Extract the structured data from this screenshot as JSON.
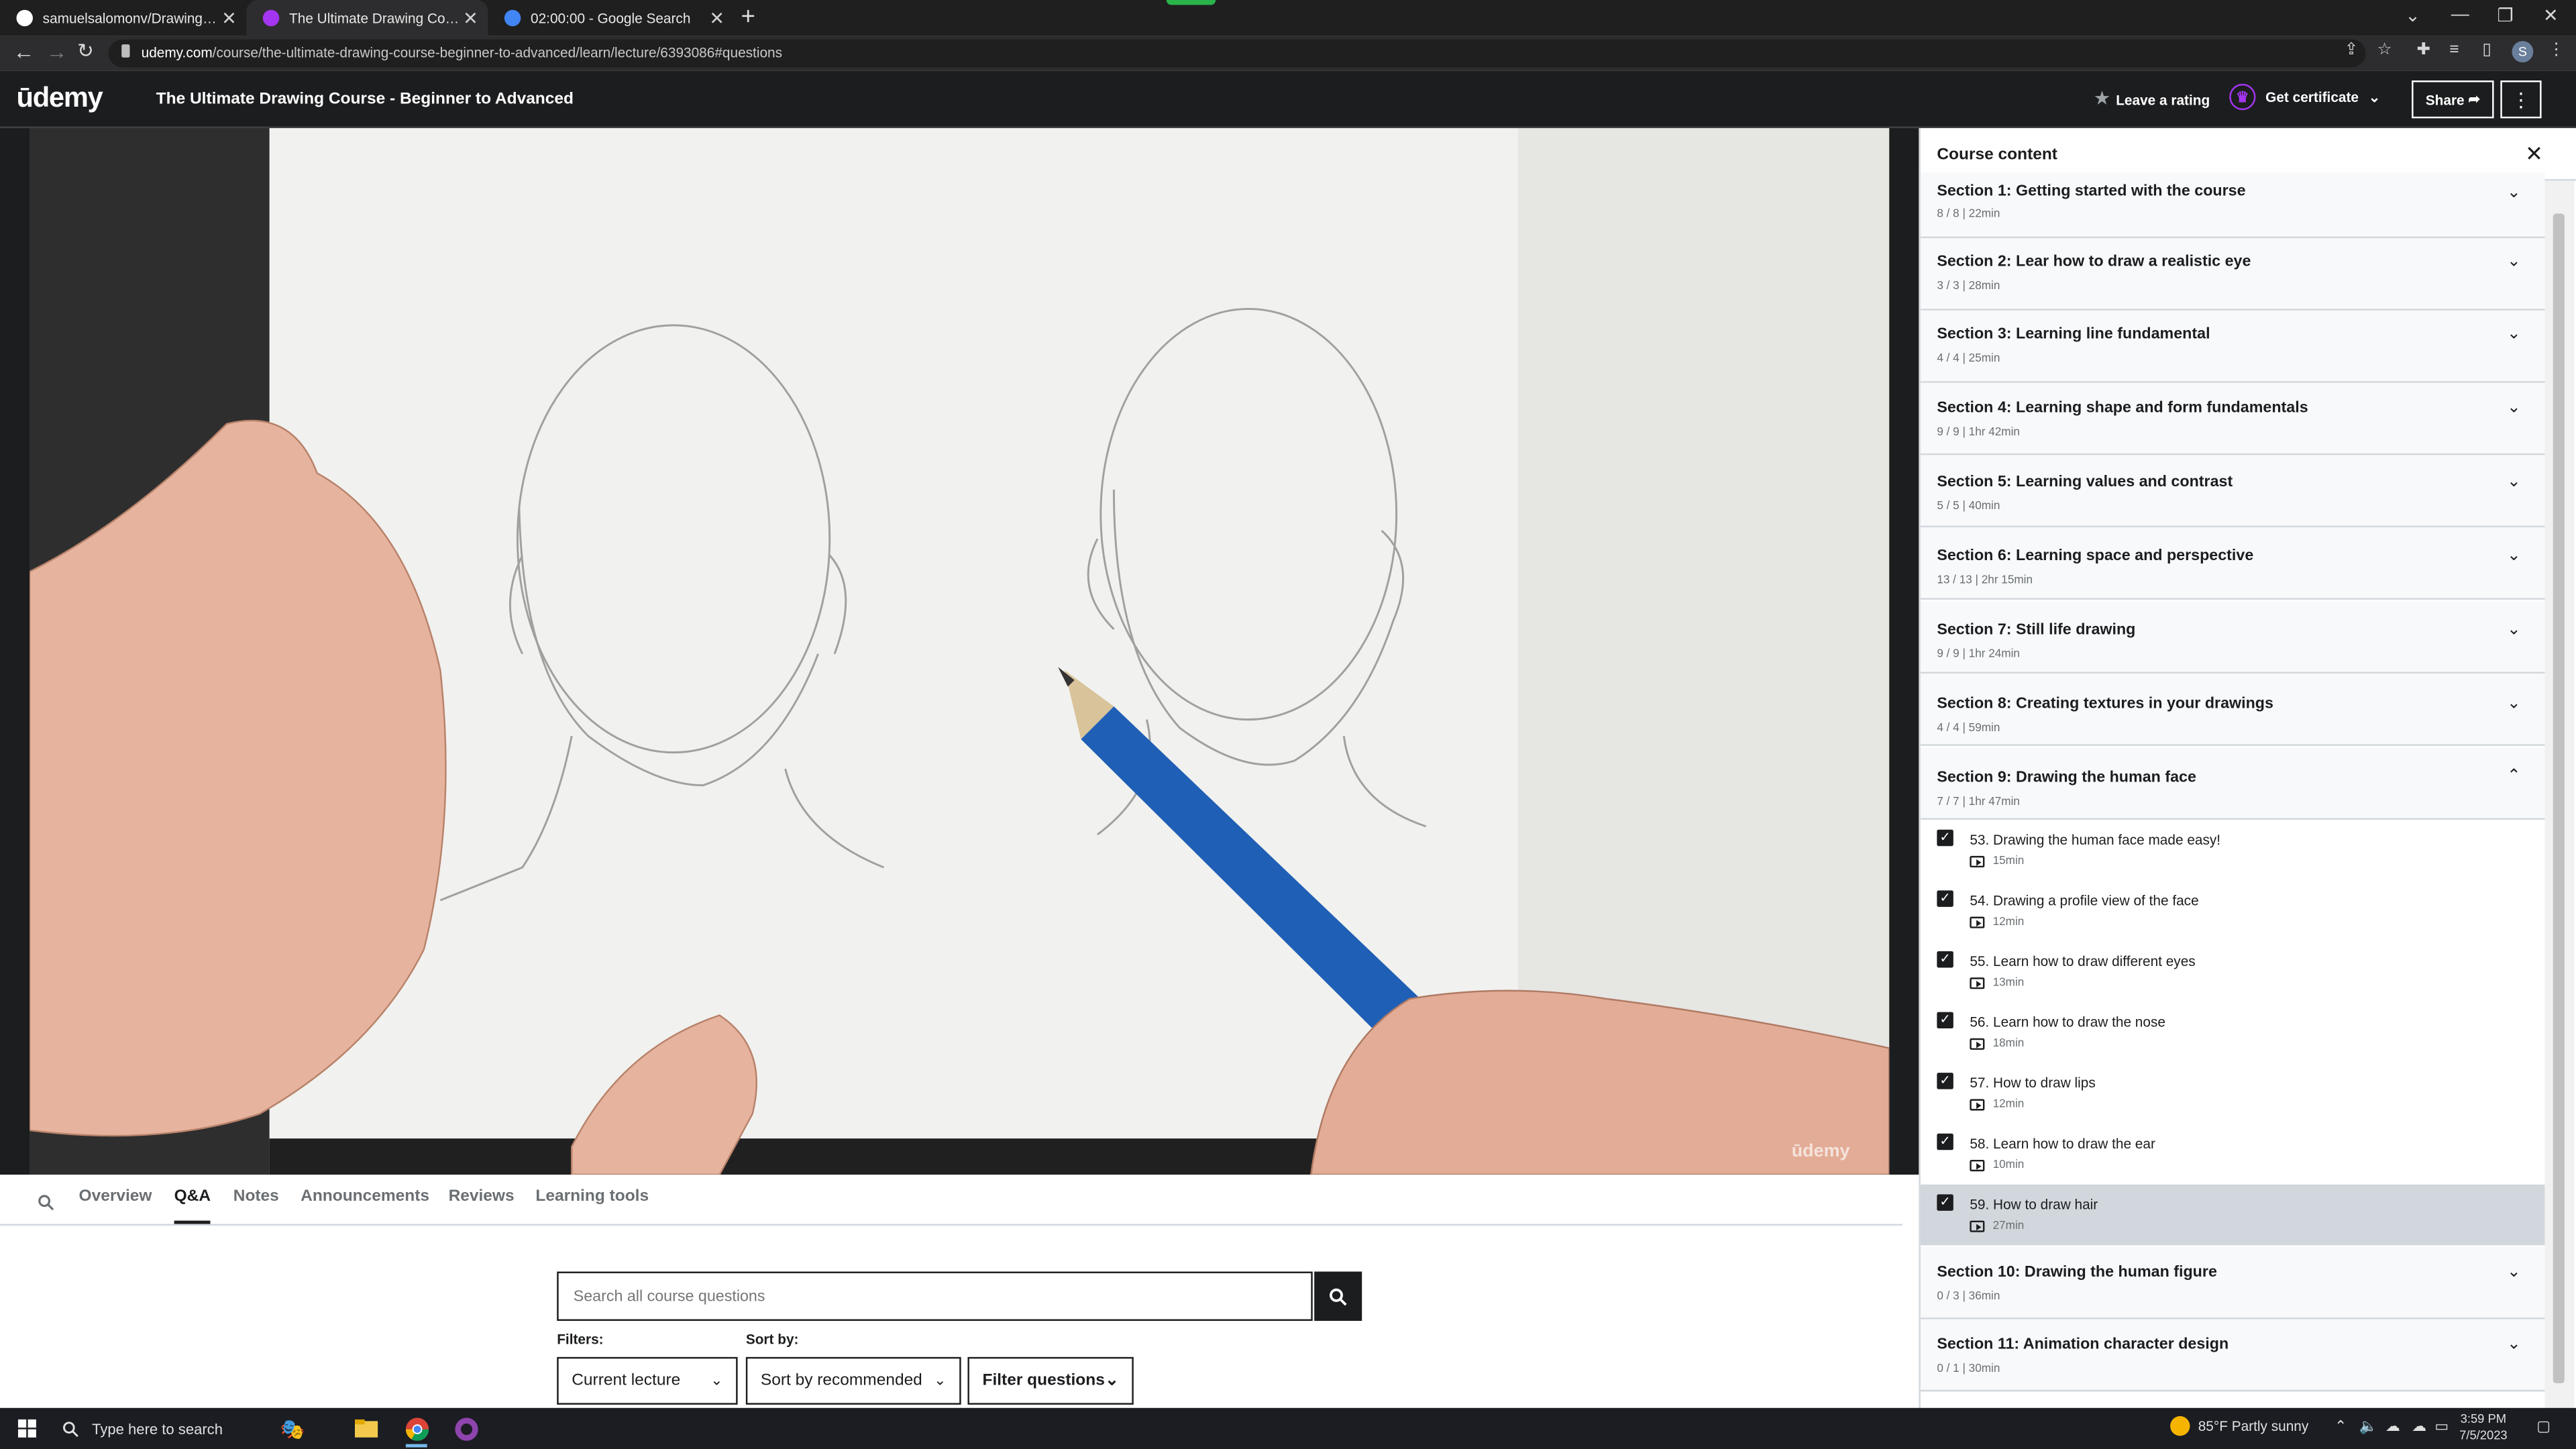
{
  "browser": {
    "tabs": [
      {
        "title": "samuelsalomonv/DrawingCourse",
        "active": false,
        "favicon": "github-icon"
      },
      {
        "title": "The Ultimate Drawing Course - B",
        "active": true,
        "favicon": "udemy-icon"
      },
      {
        "title": "02:00:00 - Google Search",
        "active": false,
        "favicon": "google-icon"
      }
    ],
    "url_host": "udemy.com",
    "url_path": "/course/the-ultimate-drawing-course-beginner-to-advanced/learn/lecture/6393086#questions"
  },
  "header": {
    "logo": "ūdemy",
    "course_title": "The Ultimate Drawing Course - Beginner to Advanced",
    "rate_label": "Leave a rating",
    "certificate_label": "Get certificate",
    "share_label": "Share",
    "accent": "#a435f0"
  },
  "video": {
    "watermark": "ūdemy"
  },
  "lower_tabs": {
    "items": [
      "Overview",
      "Q&A",
      "Notes",
      "Announcements",
      "Reviews",
      "Learning tools"
    ],
    "active": "Q&A"
  },
  "qa": {
    "search_placeholder": "Search all course questions",
    "filters_label": "Filters:",
    "sort_label": "Sort by:",
    "filter_value": "Current lecture",
    "sort_value": "Sort by recommended",
    "filter_questions_label": "Filter questions"
  },
  "sidebar": {
    "title": "Course content",
    "sections_before": [
      {
        "title": "Section 1: Getting started with the course",
        "meta": "8 / 8 | 22min"
      },
      {
        "title": "Section 2: Lear how to draw a realistic eye",
        "meta": "3 / 3 | 28min"
      },
      {
        "title": "Section 3: Learning line fundamental",
        "meta": "4 / 4 | 25min"
      },
      {
        "title": "Section 4: Learning shape and form fundamentals",
        "meta": "9 / 9 | 1hr 42min"
      },
      {
        "title": "Section 5: Learning values and contrast",
        "meta": "5 / 5 | 40min"
      },
      {
        "title": "Section 6: Learning space and perspective",
        "meta": "13 / 13 | 2hr 15min"
      },
      {
        "title": "Section 7: Still life drawing",
        "meta": "9 / 9 | 1hr 24min"
      },
      {
        "title": "Section 8: Creating textures in your drawings",
        "meta": "4 / 4 | 59min"
      },
      {
        "title": "Section 9: Drawing the human face",
        "meta": "7 / 7 | 1hr 47min"
      }
    ],
    "lectures": [
      {
        "title": "53. Drawing the human face made easy!",
        "duration": "15min",
        "current": false
      },
      {
        "title": "54. Drawing a profile view of the face",
        "duration": "12min",
        "current": false
      },
      {
        "title": "55. Learn how to draw different eyes",
        "duration": "13min",
        "current": false
      },
      {
        "title": "56. Learn how to draw the nose",
        "duration": "18min",
        "current": false
      },
      {
        "title": "57. How to draw lips",
        "duration": "12min",
        "current": false
      },
      {
        "title": "58. Learn how to draw the ear",
        "duration": "10min",
        "current": false
      },
      {
        "title": "59. How to draw hair",
        "duration": "27min",
        "current": true
      }
    ],
    "sections_after": [
      {
        "title": "Section 10: Drawing the human figure",
        "meta": "0 / 3 | 36min"
      },
      {
        "title": "Section 11: Animation character design",
        "meta": "0 / 1 | 30min"
      }
    ]
  },
  "taskbar": {
    "search_placeholder": "Type here to search",
    "weather": "85°F  Partly sunny",
    "time": "3:59 PM",
    "date": "7/5/2023"
  }
}
